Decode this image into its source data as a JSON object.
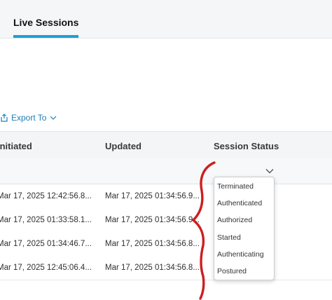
{
  "tabs": [
    {
      "label": "Live Sessions",
      "active": true
    }
  ],
  "toolbar": {
    "export_label": "Export To"
  },
  "table": {
    "columns": [
      "Initiated",
      "Updated",
      "Session Status"
    ],
    "rows": [
      {
        "initiated": "Mar 17, 2025 12:42:56.8...",
        "updated": "Mar 17, 2025 01:34:56.9..."
      },
      {
        "initiated": "Mar 17, 2025 01:33:58.1...",
        "updated": "Mar 17, 2025 01:34:56.9..."
      },
      {
        "initiated": "Mar 17, 2025 01:34:46.7...",
        "updated": "Mar 17, 2025 01:34:56.8..."
      },
      {
        "initiated": "Mar 17, 2025 12:45:06.4...",
        "updated": "Mar 17, 2025 01:34:56.8..."
      }
    ]
  },
  "status_dropdown": {
    "options": [
      "Terminated",
      "Authenticated",
      "Authorized",
      "Started",
      "Authenticating",
      "Postured"
    ]
  },
  "colors": {
    "accent": "#1ba0d7",
    "link": "#1d7fb8",
    "annotation": "#cc1f1f"
  }
}
